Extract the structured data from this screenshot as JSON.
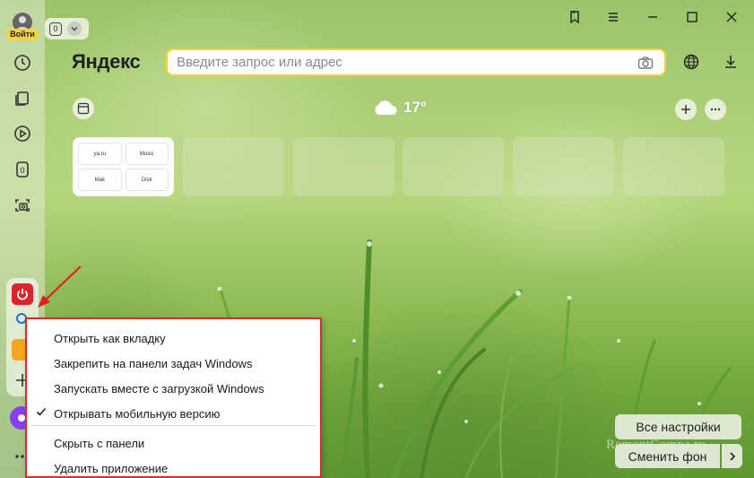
{
  "sidebar": {
    "login_label": "Войти",
    "tab_badge": "0",
    "items": [
      {
        "icon": "history-icon"
      },
      {
        "icon": "collections-icon"
      },
      {
        "icon": "play-icon"
      },
      {
        "icon": "tab-counter-icon",
        "label": "0"
      },
      {
        "icon": "screenshot-icon"
      }
    ],
    "apps": [
      {
        "icon": "power-app-icon",
        "color": "#d9252b"
      },
      {
        "icon": "search-app-icon"
      },
      {
        "icon": "mail-app-icon",
        "color": "#f5a623"
      },
      {
        "icon": "add-app-icon"
      },
      {
        "icon": "alice-icon",
        "color": "#8a3ff0"
      },
      {
        "icon": "more-icon"
      }
    ]
  },
  "tabs": {
    "count": "0"
  },
  "header": {
    "logo": "Яндекс",
    "search_placeholder": "Введите запрос или адрес"
  },
  "dashboard": {
    "temperature": "17°",
    "tiles": [
      {
        "links": [
          "ya.ru",
          "Music",
          "Mail",
          "Disk"
        ]
      },
      {
        "links": []
      },
      {
        "links": []
      },
      {
        "links": []
      },
      {
        "links": []
      },
      {
        "links": []
      }
    ]
  },
  "context_menu": {
    "items": [
      {
        "label": "Открыть как вкладку",
        "checked": false
      },
      {
        "label": "Закрепить на панели задач Windows",
        "checked": false
      },
      {
        "label": "Запускать вместе с загрузкой Windows",
        "checked": false
      },
      {
        "label": "Открывать мобильную версию",
        "checked": true
      },
      {
        "label": "Скрыть с панели",
        "checked": false
      },
      {
        "label": "Удалить приложение",
        "checked": false
      }
    ]
  },
  "footer": {
    "all_settings": "Все настройки",
    "change_bg": "Сменить фон",
    "watermark": "RemontCompa.ru"
  },
  "colors": {
    "accent": "#f5d229",
    "menu_border": "#d32f2f",
    "login_badge": "#f6d33a"
  }
}
